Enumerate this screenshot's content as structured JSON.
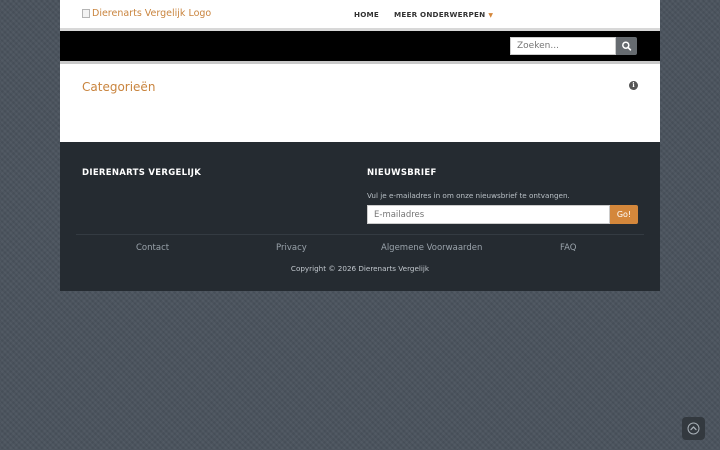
{
  "header": {
    "logo_alt": "Dierenarts Vergelijk Logo",
    "nav": {
      "home": "HOME",
      "more": "MEER ONDERWERPEN",
      "more_caret": "▼"
    }
  },
  "search": {
    "placeholder": "Zoeken...",
    "button_icon": "search-icon"
  },
  "main": {
    "title": "Categorieën",
    "info_icon": "info-icon"
  },
  "footer": {
    "brand": "DIERENARTS VERGELIJK",
    "newsletter": {
      "heading": "NIEUWSBRIEF",
      "text": "Vul je e-mailadres in om onze nieuwsbrief te ontvangen.",
      "placeholder": "E-mailadres",
      "button": "Go!"
    },
    "links": [
      "Contact",
      "Privacy",
      "Algemene Voorwaarden",
      "FAQ"
    ],
    "copyright": "Copyright © 2026 Dierenarts Vergelijk"
  },
  "back_to_top": {
    "icon": "chevron-up-icon"
  },
  "colors": {
    "accent": "#d4873b",
    "link": "#c9843e",
    "footer_bg": "#252b31",
    "page_bg": "#4a535d"
  }
}
